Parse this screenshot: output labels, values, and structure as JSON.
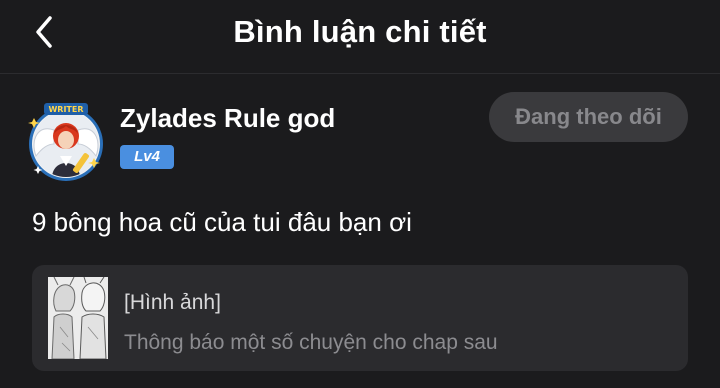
{
  "header": {
    "title": "Bình luận chi tiết",
    "back_icon": "chevron-left-icon"
  },
  "user": {
    "name": "Zylades Rule god",
    "level": "Lv4",
    "avatar_frame_label": "WRITER",
    "follow_label": "Đang theo dõi"
  },
  "comment": {
    "text": "9 bông hoa cũ của tui đâu bạn ơi"
  },
  "chapter_card": {
    "title": "[Hình ảnh]",
    "subtitle": "Thông báo một số chuyện cho chap sau"
  },
  "colors": {
    "background": "#1b1b1d",
    "card": "#2b2b2e",
    "level_badge": "#4a8fe0",
    "follow_button": "#3a3a3d"
  }
}
